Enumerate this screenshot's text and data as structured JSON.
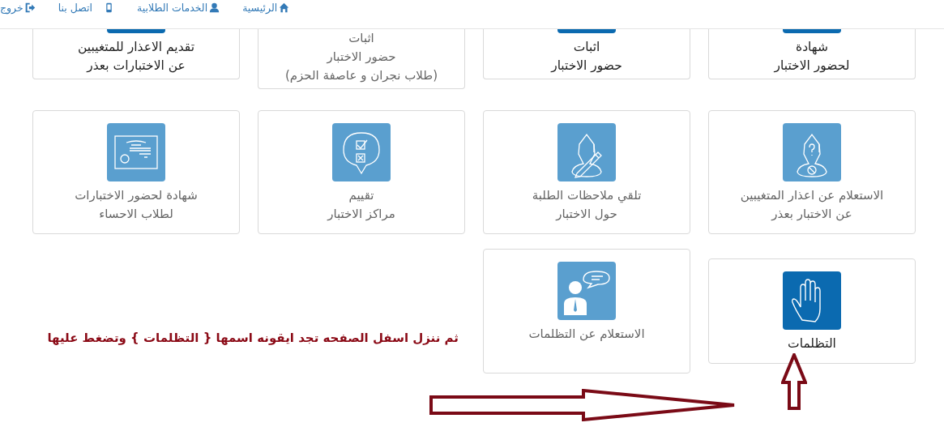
{
  "nav": [
    {
      "label": "الرئيسية",
      "kind": "home"
    },
    {
      "label": "الخدمات الطلابية",
      "kind": "user"
    },
    {
      "label": "اتصل بنا",
      "kind": "phone"
    },
    {
      "label": "خروج",
      "kind": "exit"
    }
  ],
  "rows": [
    [
      {
        "lines": [
          "شهادة",
          "لحضور الاختبار"
        ],
        "highlighted": true,
        "kind": "cut"
      },
      {
        "lines": [
          "اثبات",
          "حضور الاختبار"
        ],
        "highlighted": true,
        "kind": "cut"
      },
      {
        "lines": [
          "اثبات",
          "حضور الاختبار",
          "(طلاب نجران و عاصفة الحزم)"
        ],
        "highlighted": false,
        "kind": "plain"
      },
      {
        "lines": [
          "تقديم الاعذار للمتغيبين",
          "عن الاختبارات بعذر"
        ],
        "highlighted": true,
        "kind": "cut"
      }
    ],
    [
      {
        "lines": [
          "الاستعلام عن اعذار المتغيبين",
          "عن الاختبار بعذر"
        ],
        "highlighted": false,
        "kind": "graduate-question"
      },
      {
        "lines": [
          "تلقي ملاحظات الطلبة",
          "حول الاختبار"
        ],
        "highlighted": false,
        "kind": "graduate-pencil"
      },
      {
        "lines": [
          "تقييم",
          "مراكز الاختبار"
        ],
        "highlighted": false,
        "kind": "checklist"
      },
      {
        "lines": [
          "شهادة لحضور الاختبارات",
          "لطلاب الاحساء"
        ],
        "highlighted": false,
        "kind": "certificate"
      }
    ],
    [
      {
        "lines": [
          "التظلمات"
        ],
        "highlighted": true,
        "kind": "hand"
      },
      {
        "lines": [
          "الاستعلام عن التظلمات"
        ],
        "highlighted": false,
        "kind": "speech"
      }
    ]
  ],
  "annotation": "ثم ننزل اسفل الصفحه تجد ايقونه اسمها { التظلمات } وتضغط عليها"
}
